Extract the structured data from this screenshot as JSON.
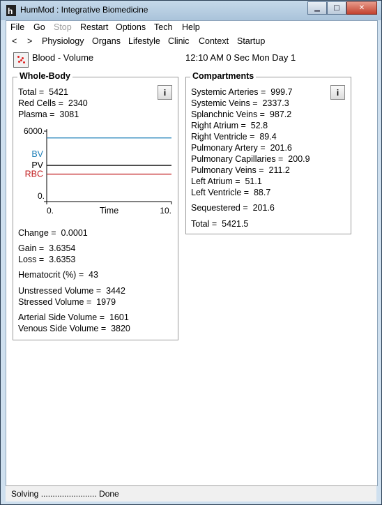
{
  "window": {
    "title": "HumMod : Integrative Biomedicine"
  },
  "menu": [
    "File",
    "Go",
    "Stop",
    "Restart",
    "Options",
    "Tech",
    "Help"
  ],
  "menu_disabled": "Stop",
  "nav": {
    "back": "<",
    "forward": ">",
    "items": [
      "Physiology",
      "Organs",
      "Lifestyle",
      "Clinic",
      "Context",
      "Startup"
    ]
  },
  "header": {
    "page_title": "Blood - Volume",
    "clock": "12:10 AM  0 Sec Mon Day 1"
  },
  "whole_body": {
    "legend": "Whole-Body",
    "info": "i",
    "total": "Total =  5421",
    "red_cells": "Red Cells =  2340",
    "plasma": "Plasma =  3081",
    "change": "Change =  0.0001",
    "gain": "Gain =  3.6354",
    "loss": "Loss =  3.6353",
    "hematocrit": "Hematocrit (%) =  43",
    "unstressed": "Unstressed Volume =  3442",
    "stressed": "Stressed Volume =  1979",
    "arterial": "Arterial Side Volume =  1601",
    "venous": "Venous Side Volume =  3820"
  },
  "chart_data": {
    "type": "line",
    "xlabel": "Time",
    "x_ticks": [
      "0.",
      "10."
    ],
    "y_ticks": [
      "6000.",
      "0."
    ],
    "xlim": [
      0,
      10
    ],
    "ylim": [
      0,
      6000
    ],
    "series": [
      {
        "name": "BV",
        "color": "#1e7fb8",
        "values": [
          5421,
          5421
        ]
      },
      {
        "name": "PV",
        "color": "#000000",
        "values": [
          3081,
          3081
        ]
      },
      {
        "name": "RBC",
        "color": "#c0181a",
        "values": [
          2340,
          2340
        ]
      }
    ],
    "x": [
      0,
      10
    ]
  },
  "compartments": {
    "legend": "Compartments",
    "info": "i",
    "rows": [
      "Systemic Arteries =  999.7",
      "Systemic Veins =  2337.3",
      "Splanchnic Veins =  987.2",
      "Right Atrium =  52.8",
      "Right Ventricle =  89.4",
      "Pulmonary Artery =  201.6",
      "Pulmonary Capillaries =  200.9",
      "Pulmonary Veins =  211.2",
      "Left Atrium =  51.1",
      "Left Ventricle =  88.7"
    ],
    "sequestered": "Sequestered =  201.6",
    "total": "Total =  5421.5"
  },
  "status": {
    "text": "Solving ........................ Done"
  }
}
